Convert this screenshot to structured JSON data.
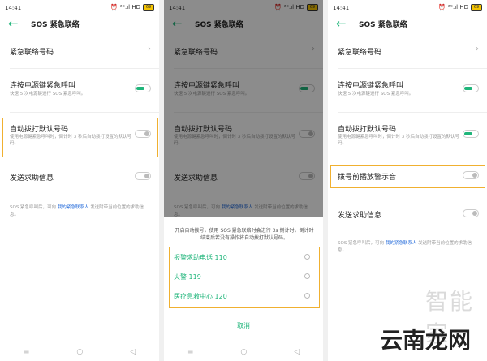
{
  "status_bar": {
    "time": "14:41",
    "network": "²ᴳ.ıl HD",
    "battery": "69"
  },
  "header": {
    "title": "SOS 紧急联络"
  },
  "settings": {
    "emergency_contact_number": "紧急联络号码",
    "power_button_call": {
      "label": "连按电源键紧急呼叫",
      "desc": "快速 5 次电源键进行 SOS 紧急呼叫。"
    },
    "auto_dial_default": {
      "label": "自动拨打默认号码",
      "desc": "使用电源键紧急呼叫时，倒计时 3 秒后自动拨打设置的默认号码。"
    },
    "dial_alert_sound": "拨号前播放警示音",
    "send_help_message": "发送求助信息",
    "footer": {
      "prefix": "SOS 紧急呼叫后，可向",
      "link": "我的紧急联系人",
      "suffix": "发送附带当前位置的求助信息。"
    }
  },
  "sheet": {
    "message": "开启自动拨号，使用 SOS 紧急联络时会进行 3s 倒计时，倒计时结束后若没有操作将自动拨打默认号码。",
    "options": [
      "报警求助电话 110",
      "火警 119",
      "医疗急救中心 120"
    ],
    "cancel": "取消"
  },
  "watermark": {
    "text": "云南龙网",
    "brand": "智能家"
  },
  "colors": {
    "accent": "#1fb57a",
    "highlight": "#f0b030",
    "link": "#2a6fdb"
  },
  "icons": {
    "back": "back-arrow-icon",
    "chevron": "chevron-right-icon",
    "nav": [
      "menu-icon",
      "home-icon",
      "back-icon"
    ]
  }
}
